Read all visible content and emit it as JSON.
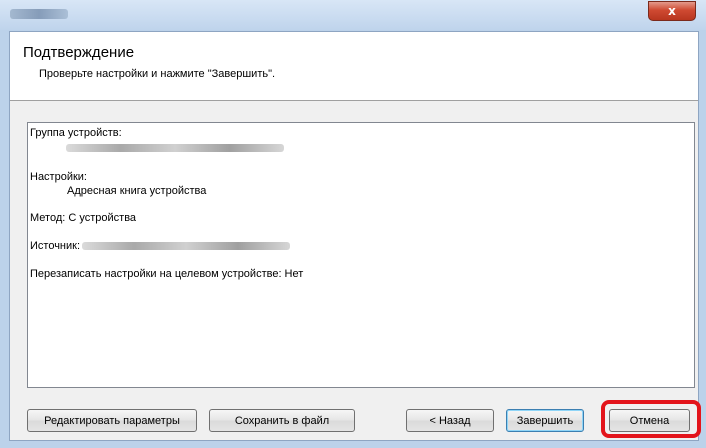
{
  "window": {
    "close_glyph": "x"
  },
  "header": {
    "title": "Подтверждение",
    "subtitle": "Проверьте настройки и нажмите \"Завершить\"."
  },
  "summary": {
    "device_group_label": "Группа устройств:",
    "settings_label": "Настройки:",
    "settings_value": "Адресная книга устройства",
    "method_line": "Метод: С устройства",
    "source_label": "Источник:",
    "overwrite_line": "Перезаписать настройки на целевом устройстве: Нет"
  },
  "buttons": {
    "edit_params": "Редактировать параметры",
    "save_to_file": "Сохранить в файл",
    "back": "< Назад",
    "finish": "Завершить",
    "cancel": "Отмена"
  },
  "colors": {
    "highlight": "#e3141b",
    "close_button": "#cf4a32"
  }
}
